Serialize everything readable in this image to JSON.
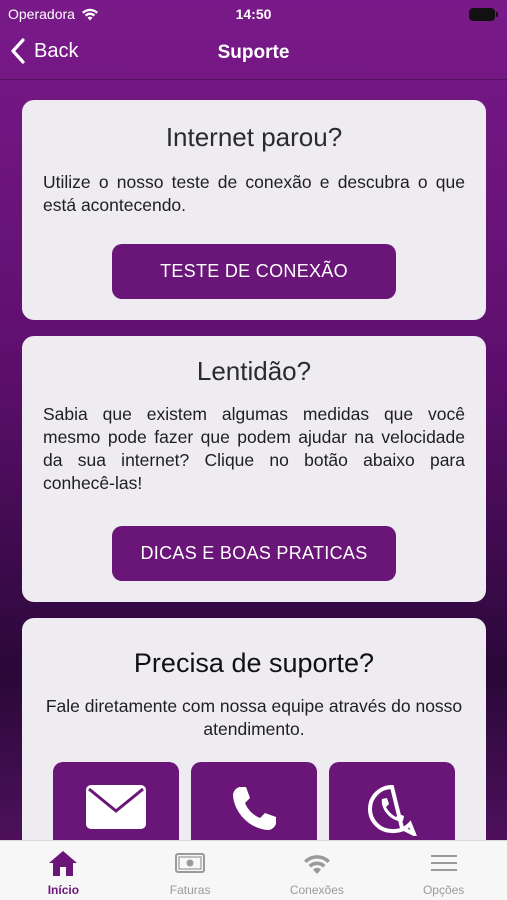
{
  "status_bar": {
    "carrier": "Operadora",
    "time": "14:50"
  },
  "nav": {
    "back_label": "Back",
    "title": "Suporte"
  },
  "cards": {
    "internet": {
      "title": "Internet parou?",
      "text": "Utilize o nosso teste de conexão e descubra o que está acontecendo.",
      "button_label": "TESTE DE CONEXÃO"
    },
    "lentidao": {
      "title": "Lentidão?",
      "text": "Sabia que existem algumas medidas que você mesmo pode fazer que podem ajudar na velocidade da sua internet? Clique no botão abaixo para conhecê-las!",
      "button_label": "DICAS E BOAS PRATICAS"
    },
    "suporte": {
      "title": "Precisa de suporte?",
      "text": "Fale diretamente com nossa equipe através do nosso atendimento.",
      "contacts": [
        {
          "icon": "envelope-icon"
        },
        {
          "icon": "phone-icon"
        },
        {
          "icon": "whatsapp-icon"
        }
      ]
    }
  },
  "tab_bar": {
    "items": [
      {
        "label": "Início",
        "icon": "home-icon",
        "active": true
      },
      {
        "label": "Faturas",
        "icon": "banknote-icon",
        "active": false
      },
      {
        "label": "Conexões",
        "icon": "wifi-icon",
        "active": false
      },
      {
        "label": "Opções",
        "icon": "menu-icon",
        "active": false
      }
    ]
  },
  "colors": {
    "primary": "#6a1578",
    "card_bg": "#eeebf1",
    "tab_active": "#6a1578",
    "tab_inactive": "#9a9a9a"
  }
}
